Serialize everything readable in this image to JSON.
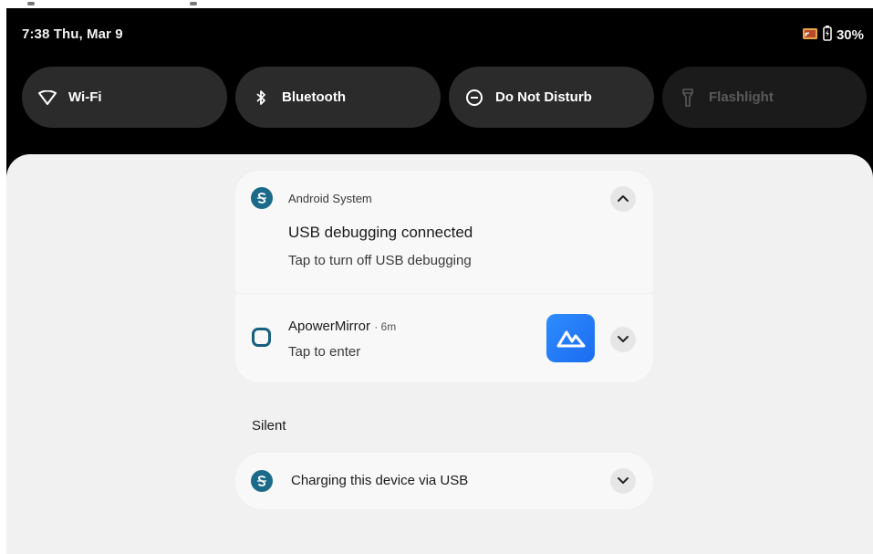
{
  "status_bar": {
    "time": "7:38 Thu, Mar 9",
    "battery": "30%",
    "icons": [
      "cast-icon",
      "battery-charging-icon"
    ]
  },
  "quick_tiles": [
    {
      "label": "Wi-Fi",
      "icon": "wifi-icon",
      "state": "on"
    },
    {
      "label": "Bluetooth",
      "icon": "bluetooth-icon",
      "state": "on"
    },
    {
      "label": "Do Not Disturb",
      "icon": "do-not-disturb-icon",
      "state": "on"
    },
    {
      "label": "Flashlight",
      "icon": "flashlight-icon",
      "state": "off"
    }
  ],
  "notifications": [
    {
      "app": "Android System",
      "title": "USB debugging connected",
      "body": "Tap to turn off USB debugging",
      "expanded": true
    },
    {
      "app": "ApowerMirror",
      "time": "· 6m",
      "body": "Tap to enter",
      "expanded": false
    }
  ],
  "silent_section": {
    "header": "Silent",
    "items": [
      {
        "title": "Charging this device via USB",
        "expanded": false
      }
    ]
  },
  "colors": {
    "shade_bg": "#000000",
    "tile_on": "#2b2b2b",
    "panel_bg": "#f1f1f1",
    "card_bg": "#f8f8f8",
    "android_icon": "#1c6a8a",
    "apower_thumb": "#2a86fb"
  }
}
